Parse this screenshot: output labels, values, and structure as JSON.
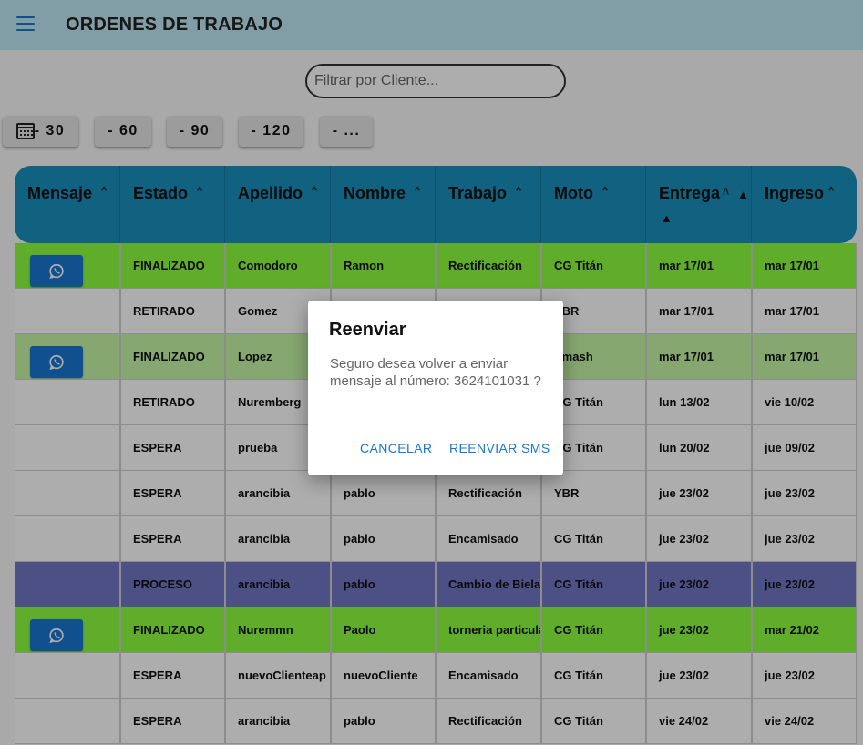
{
  "appbar": {
    "title": "ORDENES DE TRABAJO"
  },
  "search": {
    "placeholder": "Filtrar por Cliente..."
  },
  "filters": [
    {
      "label": "- 30",
      "icon": "calendar-icon"
    },
    {
      "label": "- 60"
    },
    {
      "label": "- 90"
    },
    {
      "label": "- 120"
    },
    {
      "label": "- ..."
    }
  ],
  "table": {
    "header_color": "#1a8fbe",
    "columns": [
      "Mensaje",
      "Estado",
      "Apellido",
      "Nombre",
      "Trabajo",
      "Moto",
      "Entrega",
      "Ingreso"
    ],
    "rows": [
      {
        "color": "#8cff40",
        "whatsapp": true,
        "cells": [
          "",
          "FINALIZADO",
          "Comodoro",
          "Ramon",
          "Rectificación",
          "CG Titán",
          "mar 17/01",
          "mar 17/01"
        ]
      },
      {
        "color": "#ffffff",
        "whatsapp": false,
        "cells": [
          "",
          "RETIRADO",
          "Gomez",
          "",
          "",
          "YBR",
          "mar 17/01",
          "mar 17/01"
        ]
      },
      {
        "color": "#c6f7a6",
        "whatsapp": true,
        "cells": [
          "",
          "FINALIZADO",
          "Lopez",
          "",
          "",
          "Smash",
          "mar 17/01",
          "mar 17/01"
        ]
      },
      {
        "color": "#ffffff",
        "whatsapp": false,
        "cells": [
          "",
          "RETIRADO",
          "Nuremberg",
          "",
          "",
          "CG Titán",
          "lun 13/02",
          "vie 10/02"
        ]
      },
      {
        "color": "#ffffff",
        "whatsapp": false,
        "cells": [
          "",
          "ESPERA",
          "prueba",
          "",
          "",
          "CG Titán",
          "lun 20/02",
          "jue 09/02"
        ]
      },
      {
        "color": "#ffffff",
        "whatsapp": false,
        "cells": [
          "",
          "ESPERA",
          "arancibia",
          "pablo",
          "Rectificación",
          "YBR",
          "jue 23/02",
          "jue 23/02"
        ]
      },
      {
        "color": "#ffffff",
        "whatsapp": false,
        "cells": [
          "",
          "ESPERA",
          "arancibia",
          "pablo",
          "Encamisado",
          "CG Titán",
          "jue 23/02",
          "jue 23/02"
        ]
      },
      {
        "color": "#7177c4",
        "whatsapp": false,
        "cells": [
          "",
          "PROCESO",
          "arancibia",
          "pablo",
          "Cambio de Biela",
          "CG Titán",
          "jue 23/02",
          "jue 23/02"
        ]
      },
      {
        "color": "#8cff40",
        "whatsapp": true,
        "cells": [
          "",
          "FINALIZADO",
          "Nuremmn",
          "Paolo",
          "torneria particular",
          "CG Titán",
          "jue 23/02",
          "mar 21/02"
        ]
      },
      {
        "color": "#ffffff",
        "whatsapp": false,
        "cells": [
          "",
          "ESPERA",
          "nuevoClienteap",
          "nuevoCliente",
          "Encamisado",
          "CG Titán",
          "jue 23/02",
          "jue 23/02"
        ]
      },
      {
        "color": "#ffffff",
        "whatsapp": false,
        "cells": [
          "",
          "ESPERA",
          "arancibia",
          "pablo",
          "Rectificación",
          "CG Titán",
          "vie 24/02",
          "vie 24/02"
        ]
      }
    ]
  },
  "dialog": {
    "title": "Reenviar",
    "message": "Seguro desea volver a enviar mensaje al número: 3624101031 ?",
    "cancel_label": "CANCELAR",
    "confirm_label": "REENVIAR SMS",
    "accent": "#1976d2"
  }
}
